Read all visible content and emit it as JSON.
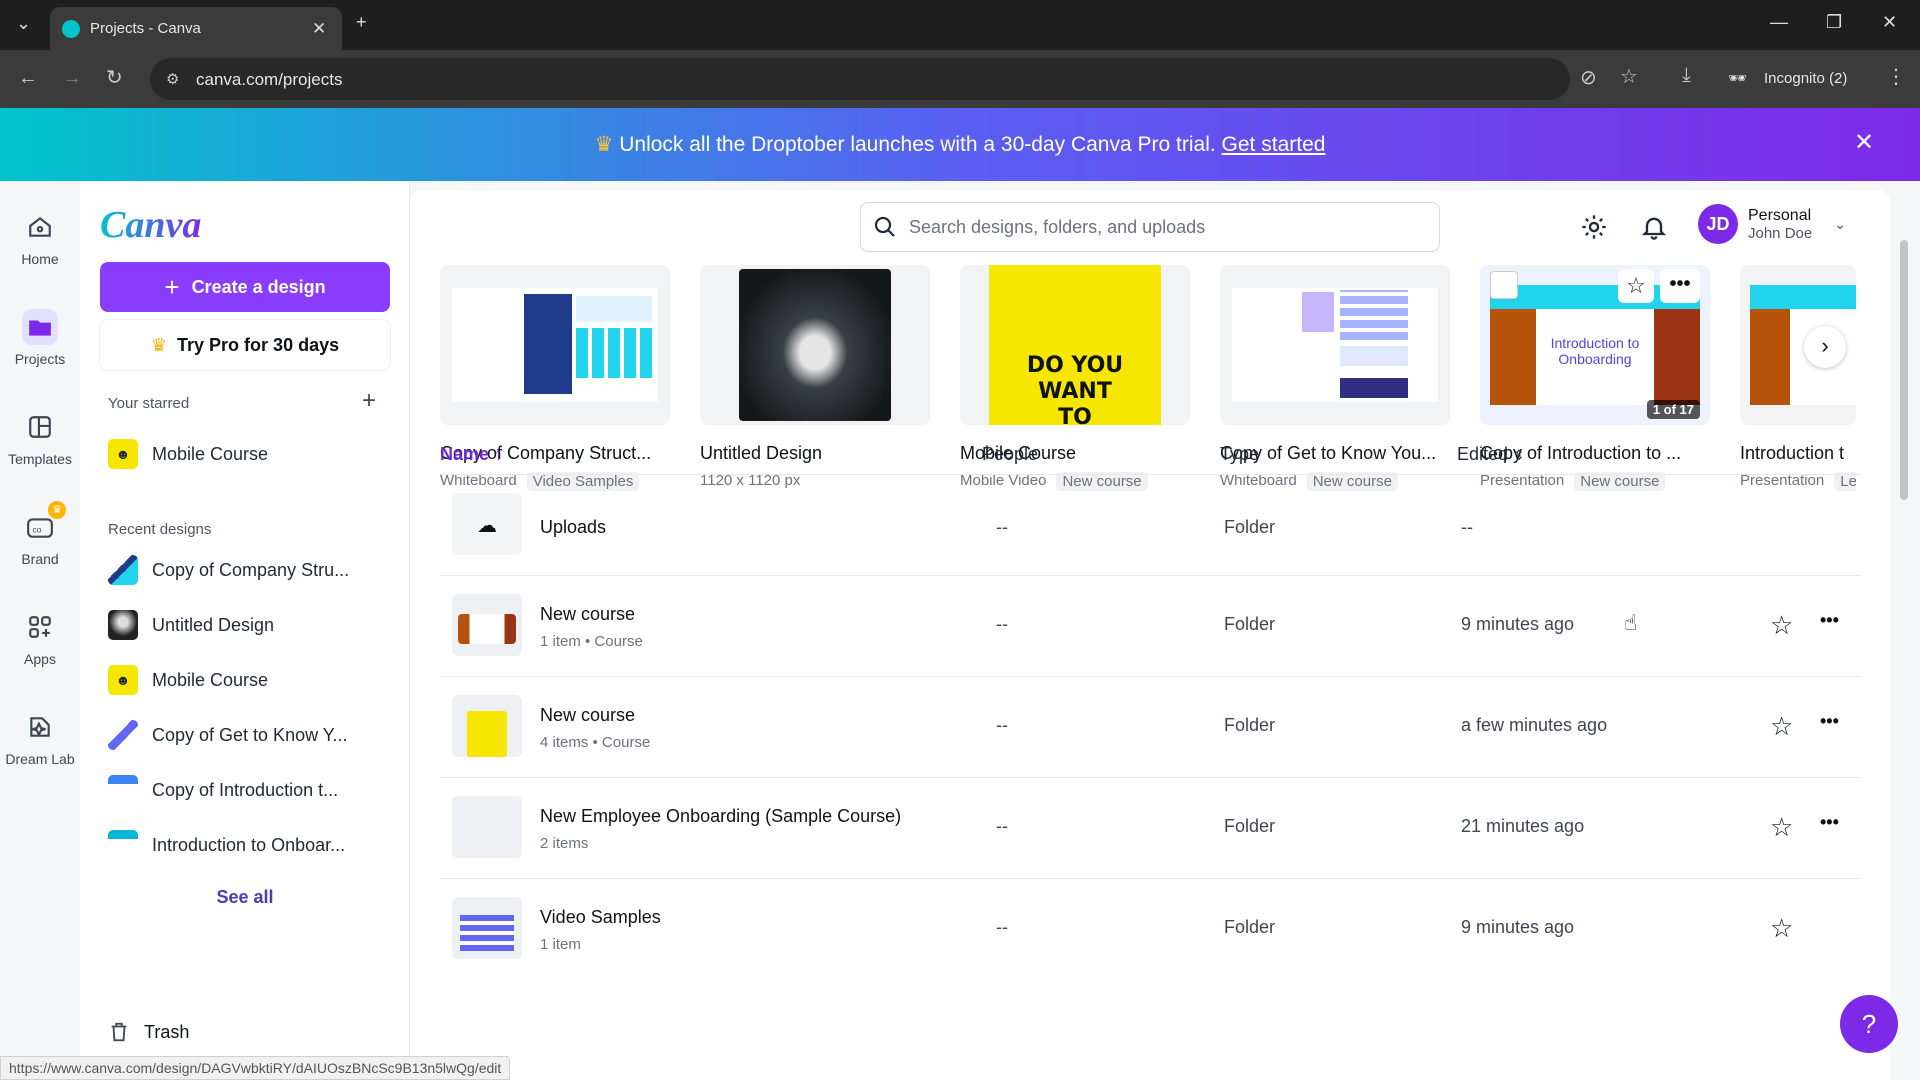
{
  "browser": {
    "tab_title": "Projects - Canva",
    "url": "canva.com/projects",
    "incognito_label": "Incognito (2)",
    "status_url": "https://www.canva.com/design/DAGVwbktiRY/dAIUOszBNcSc9B13n5lwQg/edit"
  },
  "banner": {
    "message": "Unlock all the Droptober launches with a 30-day Canva Pro trial.",
    "link": "Get started"
  },
  "rail": [
    {
      "label": "Home",
      "icon": "home-icon"
    },
    {
      "label": "Projects",
      "icon": "folder-icon"
    },
    {
      "label": "Templates",
      "icon": "templates-icon"
    },
    {
      "label": "Brand",
      "icon": "brand-icon"
    },
    {
      "label": "Apps",
      "icon": "apps-icon"
    },
    {
      "label": "Dream Lab",
      "icon": "dream-lab-icon"
    }
  ],
  "sidebar": {
    "logo": "Canva",
    "create": "Create a design",
    "try_pro": "Try Pro for 30 days",
    "starred_heading": "Your starred",
    "starred": [
      {
        "label": "Mobile Course"
      }
    ],
    "recent_heading": "Recent designs",
    "recent": [
      {
        "label": "Copy of Company Stru..."
      },
      {
        "label": "Untitled Design"
      },
      {
        "label": "Mobile Course"
      },
      {
        "label": "Copy of Get to Know Y..."
      },
      {
        "label": "Copy of Introduction t..."
      },
      {
        "label": "Introduction to Onboar..."
      }
    ],
    "see_all": "See all",
    "trash": "Trash"
  },
  "header": {
    "search_placeholder": "Search designs, folders, and uploads",
    "account_type": "Personal",
    "account_name": "John Doe",
    "avatar_initials": "JD"
  },
  "cards": [
    {
      "name": "Copy of Company Struct...",
      "meta1": "Whiteboard",
      "meta2": "Video Samples"
    },
    {
      "name": "Untitled Design",
      "meta1": "1120 x 1120 px",
      "meta2": ""
    },
    {
      "name": "Mobile Course",
      "meta1": "Mobile Video",
      "meta2": "New course",
      "thumb_text": "DO YOU WANT TO"
    },
    {
      "name": "Copy of Get to Know You...",
      "meta1": "Whiteboard",
      "meta2": "New course"
    },
    {
      "name": "Copy of Introduction to ...",
      "meta1": "Presentation",
      "meta2": "New course",
      "thumb_text": "Introduction to Onboarding",
      "badge": "1 of 17"
    },
    {
      "name": "Introduction t",
      "meta1": "Presentation",
      "meta2": "Le"
    }
  ],
  "table": {
    "headers": {
      "name": "Name",
      "people": "People",
      "type": "Type",
      "edited": "Edited"
    },
    "rows": [
      {
        "name": "Uploads",
        "sub": "",
        "people": "--",
        "type": "Folder",
        "edited": "--"
      },
      {
        "name": "New course",
        "sub": "1 item • Course",
        "people": "--",
        "type": "Folder",
        "edited": "9 minutes ago"
      },
      {
        "name": "New course",
        "sub": "4 items • Course",
        "people": "--",
        "type": "Folder",
        "edited": "a few minutes ago"
      },
      {
        "name": "New Employee Onboarding (Sample Course)",
        "sub": "2 items",
        "people": "--",
        "type": "Folder",
        "edited": "21 minutes ago"
      },
      {
        "name": "Video Samples",
        "sub": "1 item",
        "people": "--",
        "type": "Folder",
        "edited": "9 minutes ago"
      }
    ]
  },
  "help": "?"
}
